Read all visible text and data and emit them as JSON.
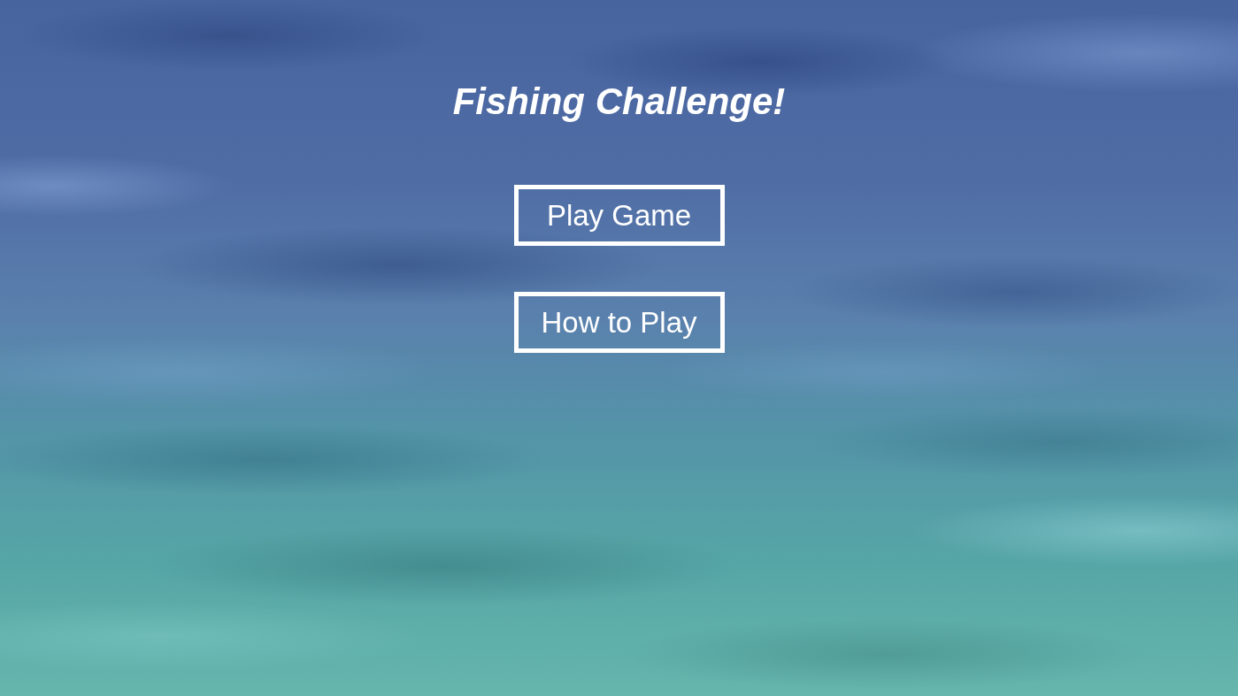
{
  "title": "Fishing Challenge!",
  "menu": [
    {
      "label": "Play Game"
    },
    {
      "label": "How to Play"
    }
  ]
}
